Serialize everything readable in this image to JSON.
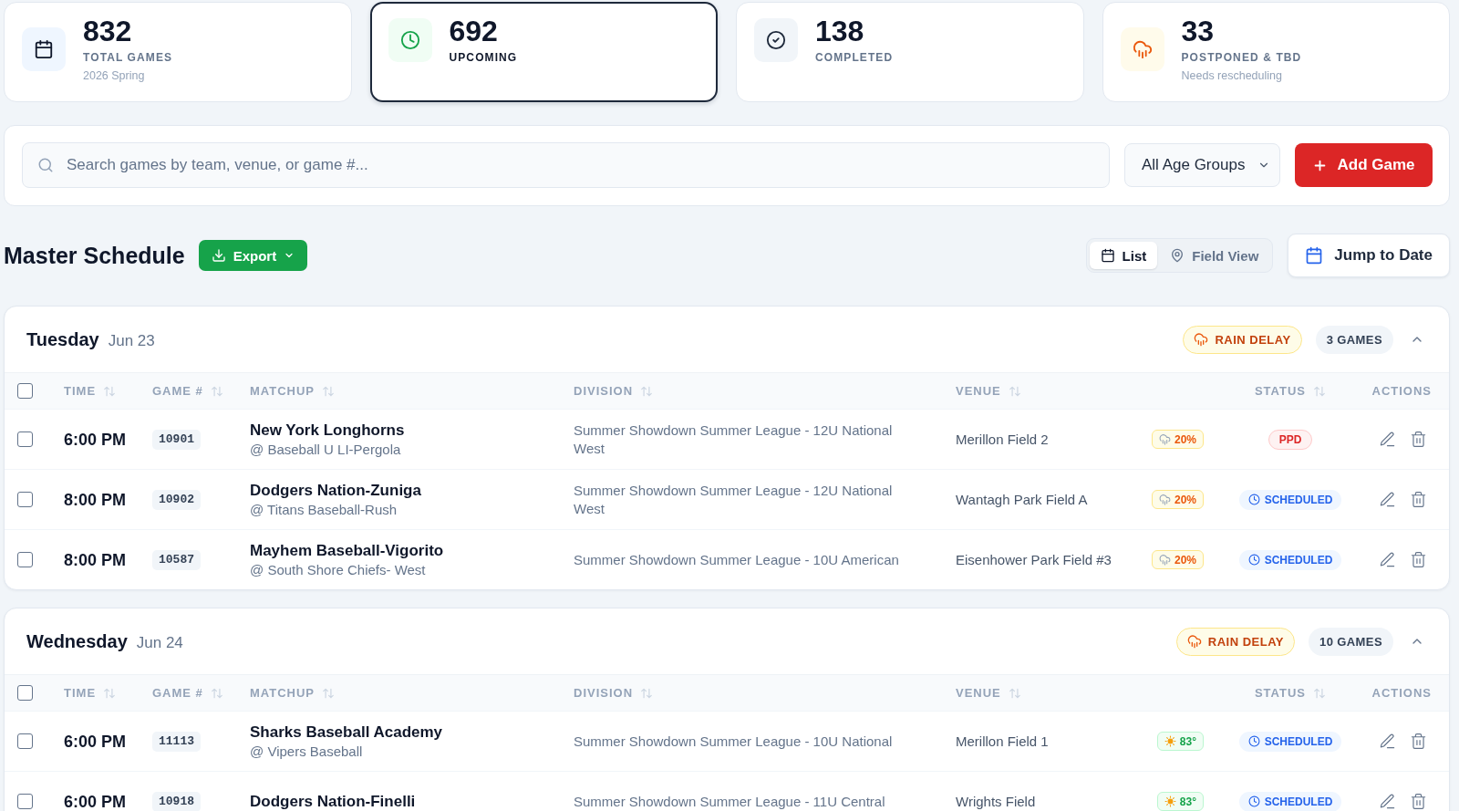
{
  "stats": [
    {
      "kind": "calendar",
      "value": "832",
      "label": "TOTAL GAMES",
      "subtitle": "2026 Spring",
      "selected": false
    },
    {
      "kind": "clock",
      "value": "692",
      "label": "UPCOMING",
      "selected": true
    },
    {
      "kind": "check",
      "value": "138",
      "label": "COMPLETED",
      "selected": false
    },
    {
      "kind": "rain",
      "value": "33",
      "label": "POSTPONED & TBD",
      "subtitle": "Needs rescheduling",
      "selected": false
    }
  ],
  "filters": {
    "search": {
      "placeholder": "Search games by team, venue, or game #..."
    },
    "age_group": {
      "value": "All Age Groups"
    },
    "add_button": {
      "label": "Add Game"
    }
  },
  "schedule_header": {
    "title": "Master Schedule",
    "export_button": {
      "label": "Export"
    },
    "views": [
      {
        "kind": "list",
        "label": "List",
        "selected": true
      },
      {
        "kind": "field",
        "label": "Field View",
        "selected": false
      }
    ],
    "jump_button": {
      "label": "Jump to Date"
    }
  },
  "days": [
    {
      "weekday": "Tuesday",
      "date": "Jun 23",
      "alert": "RAIN DELAY",
      "count": "3 GAMES",
      "expanded": true,
      "all_checked": false,
      "columns": [
        {
          "label": "TIME",
          "sortable": true
        },
        {
          "label": "GAME #",
          "sortable": true
        },
        {
          "label": "MATCHUP",
          "sortable": true
        },
        {
          "label": "DIVISION",
          "sortable": true
        },
        {
          "label": "VENUE",
          "sortable": true
        },
        {
          "label": "STATUS",
          "sortable": true
        },
        {
          "label": "ACTIONS",
          "sortable": false
        }
      ],
      "games": [
        {
          "checked": false,
          "time": "6:00 PM",
          "game_no": "10901",
          "home": "New York Longhorns",
          "away": "@ Baseball U LI-Pergola",
          "division": "Summer Showdown Summer League - 12U National West",
          "venue": "Merillon Field 2",
          "weather": {
            "kind": "rain",
            "reading": "20%"
          },
          "status": {
            "kind": "postponed",
            "label": "PPD"
          }
        },
        {
          "checked": false,
          "time": "8:00 PM",
          "game_no": "10902",
          "home": "Dodgers Nation-Zuniga",
          "away": "@ Titans Baseball-Rush",
          "division": "Summer Showdown Summer League - 12U National West",
          "venue": "Wantagh Park Field A",
          "weather": {
            "kind": "rain",
            "reading": "20%"
          },
          "status": {
            "kind": "scheduled",
            "label": "SCHEDULED"
          }
        },
        {
          "checked": false,
          "time": "8:00 PM",
          "game_no": "10587",
          "home": "Mayhem Baseball-Vigorito",
          "away": "@ South Shore Chiefs- West",
          "division": "Summer Showdown Summer League - 10U American",
          "venue": "Eisenhower Park Field #3",
          "weather": {
            "kind": "rain",
            "reading": "20%"
          },
          "status": {
            "kind": "scheduled",
            "label": "SCHEDULED"
          }
        }
      ]
    },
    {
      "weekday": "Wednesday",
      "date": "Jun 24",
      "alert": "RAIN DELAY",
      "count": "10 GAMES",
      "expanded": true,
      "all_checked": false,
      "columns": [
        {
          "label": "TIME",
          "sortable": true
        },
        {
          "label": "GAME #",
          "sortable": true
        },
        {
          "label": "MATCHUP",
          "sortable": true
        },
        {
          "label": "DIVISION",
          "sortable": true
        },
        {
          "label": "VENUE",
          "sortable": true
        },
        {
          "label": "STATUS",
          "sortable": true
        },
        {
          "label": "ACTIONS",
          "sortable": false
        }
      ],
      "games": [
        {
          "checked": false,
          "time": "6:00 PM",
          "game_no": "11113",
          "home": "Sharks Baseball Academy",
          "away": "@ Vipers Baseball",
          "division": "Summer Showdown Summer League - 10U National",
          "venue": "Merillon Field 1",
          "weather": {
            "kind": "sun",
            "reading": "83°"
          },
          "status": {
            "kind": "scheduled",
            "label": "SCHEDULED"
          }
        },
        {
          "checked": false,
          "time": "6:00 PM",
          "game_no": "10918",
          "home": "Dodgers Nation-Finelli",
          "division": "Summer Showdown Summer League - 11U Central",
          "venue": "Wrights Field",
          "weather": {
            "kind": "sun",
            "reading": "83°"
          },
          "status": {
            "kind": "scheduled",
            "label": "SCHEDULED"
          }
        }
      ]
    }
  ]
}
